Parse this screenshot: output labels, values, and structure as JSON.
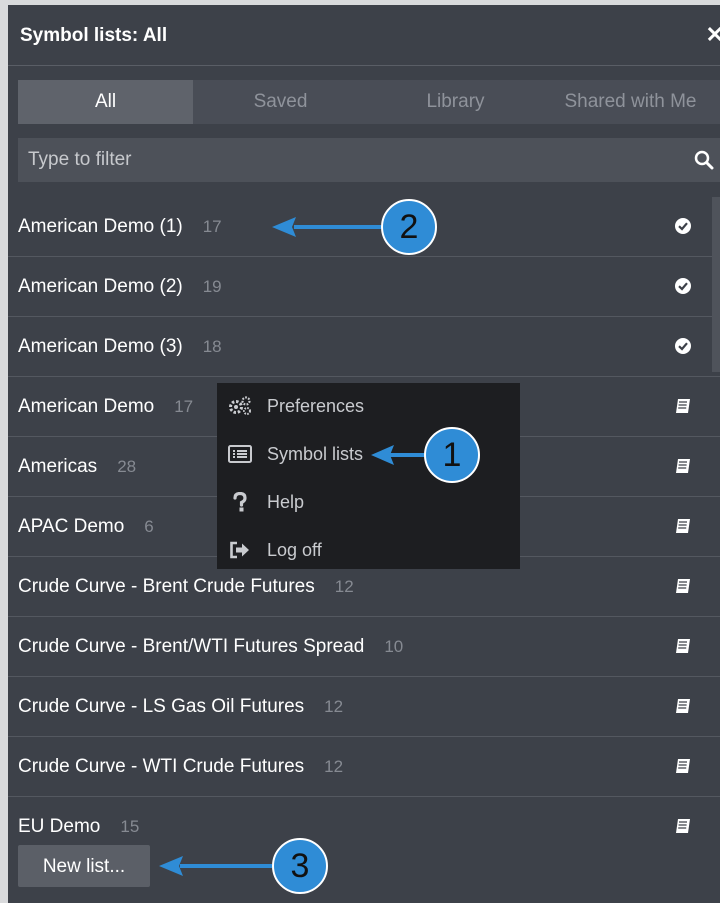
{
  "header": {
    "title": "Symbol lists: All",
    "close_glyph": "✕"
  },
  "tabs": [
    {
      "label": "All",
      "active": true
    },
    {
      "label": "Saved",
      "active": false
    },
    {
      "label": "Library",
      "active": false
    },
    {
      "label": "Shared with Me",
      "active": false
    }
  ],
  "filter": {
    "placeholder": "Type to filter",
    "value": ""
  },
  "lists": [
    {
      "name": "American Demo (1)",
      "count": "17",
      "icon": "check-circle-icon"
    },
    {
      "name": "American Demo (2)",
      "count": "19",
      "icon": "check-circle-icon"
    },
    {
      "name": "American Demo (3)",
      "count": "18",
      "icon": "check-circle-icon"
    },
    {
      "name": "American Demo",
      "count": "17",
      "icon": "book-icon"
    },
    {
      "name": "Americas",
      "count": "28",
      "icon": "book-icon"
    },
    {
      "name": "APAC Demo",
      "count": "6",
      "icon": "book-icon"
    },
    {
      "name": "Crude Curve - Brent Crude Futures",
      "count": "12",
      "icon": "book-icon"
    },
    {
      "name": "Crude Curve - Brent/WTI Futures Spread",
      "count": "10",
      "icon": "book-icon"
    },
    {
      "name": "Crude Curve - LS Gas Oil Futures",
      "count": "12",
      "icon": "book-icon"
    },
    {
      "name": "Crude Curve - WTI Crude Futures",
      "count": "12",
      "icon": "book-icon"
    },
    {
      "name": "EU Demo",
      "count": "15",
      "icon": "book-icon"
    }
  ],
  "footer": {
    "new_list_label": "New list..."
  },
  "menu": {
    "items": [
      {
        "label": "Preferences",
        "icon": "gears-icon"
      },
      {
        "label": "Symbol lists",
        "icon": "list-icon"
      },
      {
        "label": "Help",
        "icon": "question-icon"
      },
      {
        "label": "Log off",
        "icon": "log-off-icon"
      }
    ]
  },
  "annotations": [
    {
      "number": "1"
    },
    {
      "number": "2"
    },
    {
      "number": "3"
    }
  ],
  "colors": {
    "panel": "#3d4149",
    "menu": "#1d1e21",
    "badge": "#2f8cd6"
  }
}
